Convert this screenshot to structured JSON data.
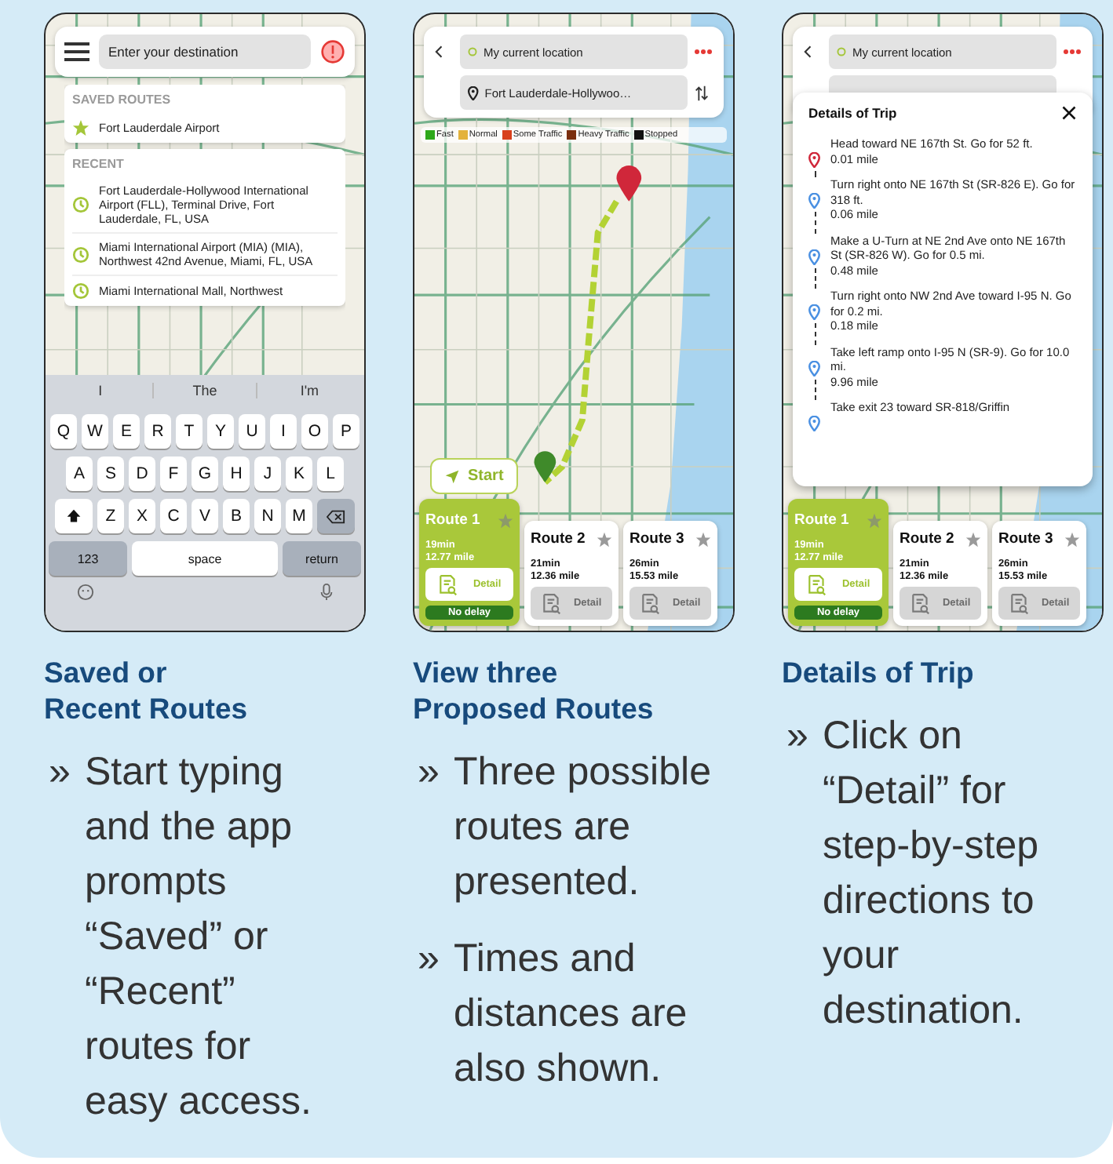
{
  "panels": [
    {
      "kind": "search",
      "heading": "Saved or\nRecent Routes",
      "phone": {
        "search": {
          "placeholder": "Enter your destination"
        },
        "saved": {
          "title": "SAVED ROUTES",
          "items": [
            "Fort Lauderdale Airport"
          ]
        },
        "recent": {
          "title": "RECENT",
          "items": [
            "Fort Lauderdale-Hollywood International Airport (FLL), Terminal Drive, Fort Lauderdale, FL, USA",
            "Miami International Airport (MIA) (MIA), Northwest 42nd Avenue, Miami, FL, USA",
            "Miami International Mall, Northwest"
          ]
        },
        "keyboard": {
          "suggestions": [
            "I",
            "The",
            "I'm"
          ],
          "rows": [
            [
              "Q",
              "W",
              "E",
              "R",
              "T",
              "Y",
              "U",
              "I",
              "O",
              "P"
            ],
            [
              "A",
              "S",
              "D",
              "F",
              "G",
              "H",
              "J",
              "K",
              "L"
            ],
            [
              "Z",
              "X",
              "C",
              "V",
              "B",
              "N",
              "M"
            ]
          ],
          "number_key": "123",
          "space_key": "space",
          "return_key": "return"
        }
      },
      "bullets": [
        {
          "marker": "»",
          "text": "Start typing and the app prompts “Saved” or “Recent” routes for easy access."
        }
      ]
    },
    {
      "kind": "routes",
      "heading": "View three\nProposed Routes",
      "phone": {
        "origin": "My current location",
        "destination": "Fort Lauderdale-Hollywoo…",
        "legend": [
          {
            "label": "Fast",
            "color": "#2ea81a"
          },
          {
            "label": "Normal",
            "color": "#e3b23c"
          },
          {
            "label": "Some Traffic",
            "color": "#d8401c"
          },
          {
            "label": "Heavy Traffic",
            "color": "#7a2e0e"
          },
          {
            "label": "Stopped",
            "color": "#111111"
          }
        ],
        "start_label": "Start",
        "routes": [
          {
            "name": "Route 1",
            "time": "19min",
            "distance": "12.77 mile",
            "detail_label": "Detail",
            "selected": true,
            "badge": "No delay"
          },
          {
            "name": "Route 2",
            "time": "21min",
            "distance": "12.36 mile",
            "detail_label": "Detail",
            "selected": false
          },
          {
            "name": "Route 3",
            "time": "26min",
            "distance": "15.53 mile",
            "detail_label": "Detail",
            "selected": false
          }
        ]
      },
      "bullets": [
        {
          "marker": "»",
          "text": "Three possible routes are presented."
        },
        {
          "marker": "»",
          "text": "Times and distances are also shown."
        }
      ]
    },
    {
      "kind": "details",
      "heading": "Details of Trip",
      "phone": {
        "origin": "My current location",
        "details": {
          "title": "Details of Trip",
          "steps": [
            {
              "kind": "start",
              "text": "Head toward NE 167th St. Go for 52 ft.",
              "distance": "0.01 mile"
            },
            {
              "kind": "turn",
              "text": "Turn right onto NE 167th St (SR-826 E). Go for 318 ft.",
              "distance": "0.06 mile"
            },
            {
              "kind": "turn",
              "text": "Make a U-Turn at NE 2nd Ave onto NE 167th St (SR-826 W). Go for 0.5 mi.",
              "distance": "0.48 mile"
            },
            {
              "kind": "turn",
              "text": "Turn right onto NW 2nd Ave toward I-95 N. Go for 0.2 mi.",
              "distance": "0.18 mile"
            },
            {
              "kind": "turn",
              "text": "Take left ramp onto I-95 N (SR-9). Go for 10.0 mi.",
              "distance": "9.96 mile"
            },
            {
              "kind": "turn",
              "text": "Take exit 23 toward SR-818/Griffin"
            }
          ]
        },
        "routes": [
          {
            "name": "Route 1",
            "time": "19min",
            "distance": "12.77 mile",
            "detail_label": "Detail",
            "selected": true,
            "badge": "No delay"
          },
          {
            "name": "Route 2",
            "time": "21min",
            "distance": "12.36 mile",
            "detail_label": "Detail",
            "selected": false
          },
          {
            "name": "Route 3",
            "time": "26min",
            "distance": "15.53 mile",
            "detail_label": "Detail",
            "selected": false
          }
        ]
      },
      "bullets": [
        {
          "marker": "»",
          "text": "Click on “Detail” for step-by-step directions to your destination."
        }
      ]
    }
  ]
}
